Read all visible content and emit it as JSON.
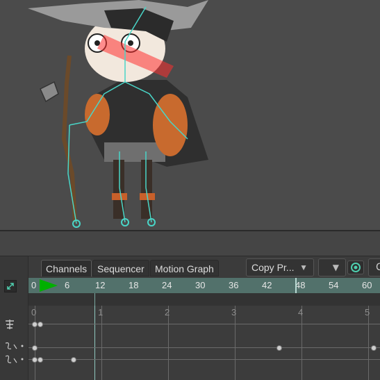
{
  "tabs": {
    "channels": "Channels",
    "sequencer": "Sequencer",
    "motion_graph": "Motion Graph"
  },
  "toolbar": {
    "copy_dropdown": "Copy Pr...",
    "dropdown_arrow": "▼",
    "more": "C"
  },
  "ruler": {
    "start": "0",
    "ticks": [
      "6",
      "12",
      "18",
      "24",
      "30",
      "36",
      "42",
      "48",
      "54",
      "60"
    ]
  },
  "graph": {
    "seconds": [
      "0",
      "1",
      "2",
      "3",
      "4",
      "5"
    ]
  },
  "colors": {
    "ruler_bg": "#52716b",
    "playhead": "#00b000",
    "bone": "#49d6c8"
  }
}
